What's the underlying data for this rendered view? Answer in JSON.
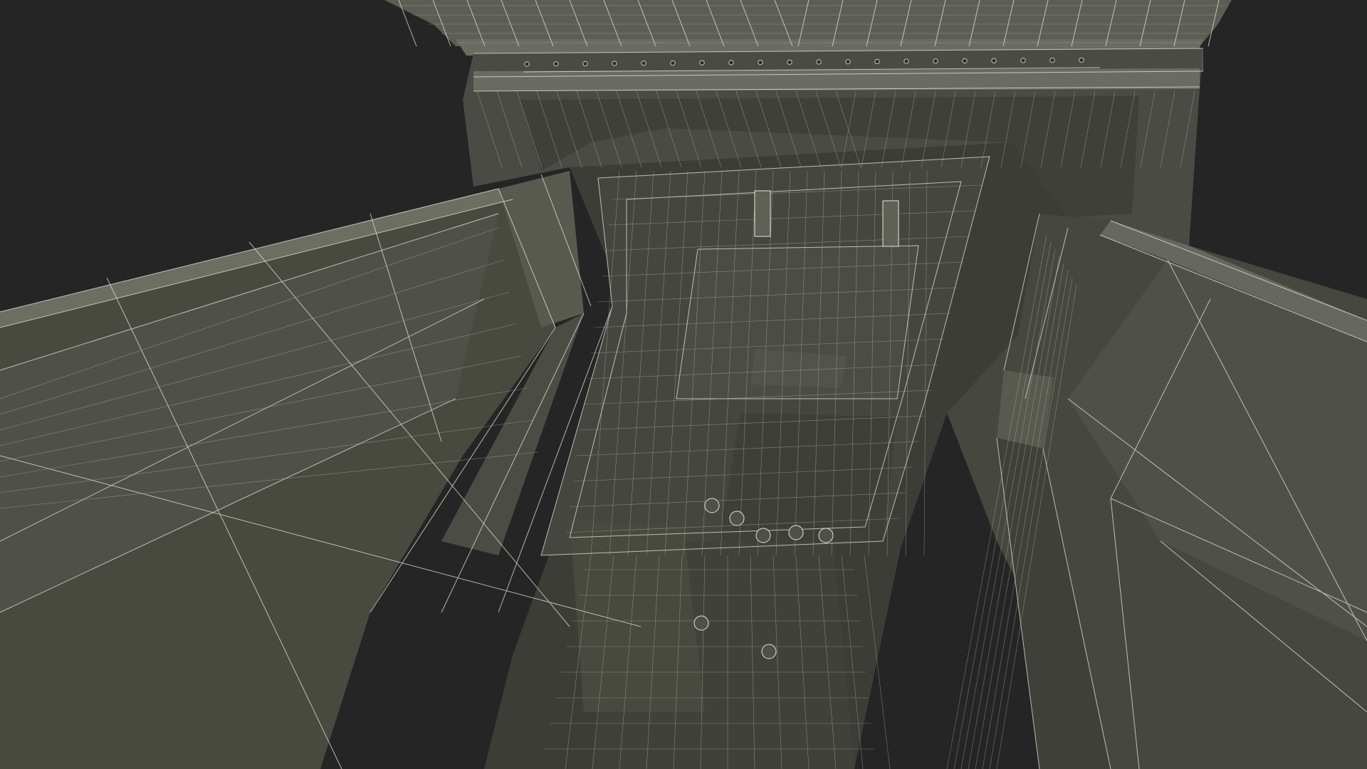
{
  "scene": {
    "subject": "wireframe-3d-model",
    "render_style": "wireframe-over-shaded",
    "colors": {
      "background": "#252525",
      "surface_dark": "#45463f",
      "surface_mid": "#53554c",
      "surface_light": "#6b6d63",
      "wire_bright": "#e6e8dc",
      "wire_soft": "#b9bcae"
    }
  }
}
